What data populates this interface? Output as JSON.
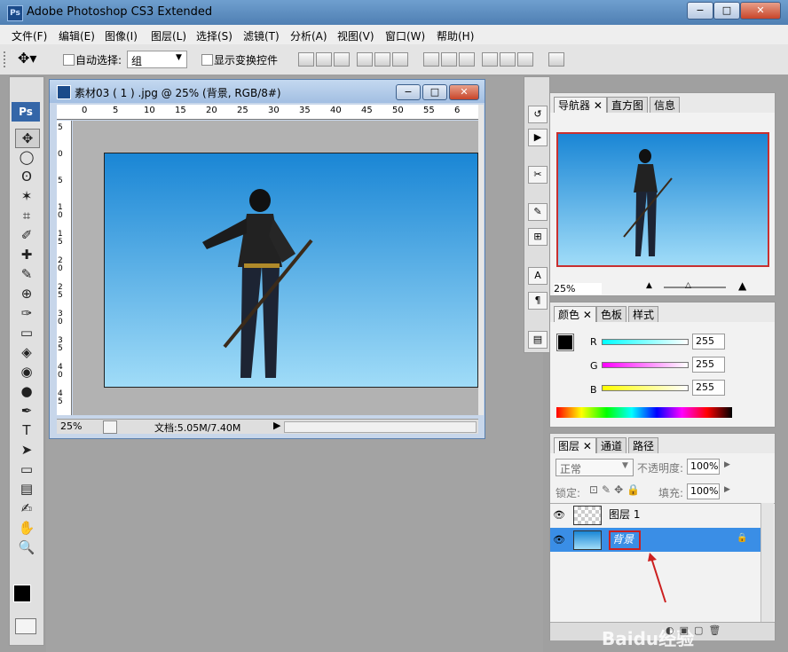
{
  "app": {
    "icon": "Ps",
    "title": "Adobe Photoshop CS3 Extended"
  },
  "window_controls": {
    "minimize": "−",
    "maximize": "□",
    "close": "✕"
  },
  "menu": [
    "文件(F)",
    "编辑(E)",
    "图像(I)",
    "图层(L)",
    "选择(S)",
    "滤镜(T)",
    "分析(A)",
    "视图(V)",
    "窗口(W)",
    "帮助(H)"
  ],
  "options": {
    "auto_select_label": "自动选择:",
    "auto_select_value": "组",
    "show_transform_label": "显示变换控件"
  },
  "toolbox": {
    "badge": "Ps",
    "tools": [
      "move",
      "marquee",
      "lasso",
      "magic-wand",
      "crop",
      "slice",
      "healing",
      "brush",
      "stamp",
      "history-brush",
      "eraser",
      "paint-bucket",
      "blur",
      "dodge",
      "pen",
      "type",
      "path-select",
      "shape",
      "notes",
      "eyedropper",
      "hand",
      "zoom"
    ],
    "tool_glyphs": [
      "✥",
      "◯",
      "ʘ",
      "✶",
      "⌗",
      "✐",
      "✚",
      "✎",
      "⊕",
      "✑",
      "▭",
      "◈",
      "◉",
      "●",
      "✒",
      "T",
      "➤",
      "▭",
      "▤",
      "✍",
      "✋",
      "🔍"
    ]
  },
  "document": {
    "title": "素材03 ( 1 ) .jpg @ 25% (背景, RGB/8#)",
    "ruler_h": [
      "0",
      "5",
      "10",
      "15",
      "20",
      "25",
      "30",
      "35",
      "40",
      "45",
      "50",
      "55",
      "6"
    ],
    "ruler_v": [
      "5",
      "0",
      "5",
      "1 0",
      "1 5",
      "2 0",
      "2 5",
      "3 0",
      "3 5",
      "4 0",
      "4 5"
    ],
    "zoom": "25%",
    "doc_size": "文档:5.05M/7.40M"
  },
  "navigator": {
    "tabs": [
      "导航器",
      "直方图",
      "信息"
    ],
    "zoom": "25%"
  },
  "color": {
    "tabs": [
      "颜色",
      "色板",
      "样式"
    ],
    "channels": [
      {
        "label": "R",
        "value": "255"
      },
      {
        "label": "G",
        "value": "255"
      },
      {
        "label": "B",
        "value": "255"
      }
    ]
  },
  "layers": {
    "tabs": [
      "图层",
      "通道",
      "路径"
    ],
    "blend_mode": "正常",
    "opacity_label": "不透明度:",
    "opacity": "100%",
    "lock_label": "锁定:",
    "fill_label": "填充:",
    "fill": "100%",
    "items": [
      {
        "name": "图层 1",
        "selected": false
      },
      {
        "name": "背景",
        "selected": true
      }
    ],
    "watermark": "Baidu经验"
  },
  "colors": {
    "accent": "#3a8ee6",
    "selection": "#3a8ee6",
    "annotation": "#cc1f1f"
  }
}
